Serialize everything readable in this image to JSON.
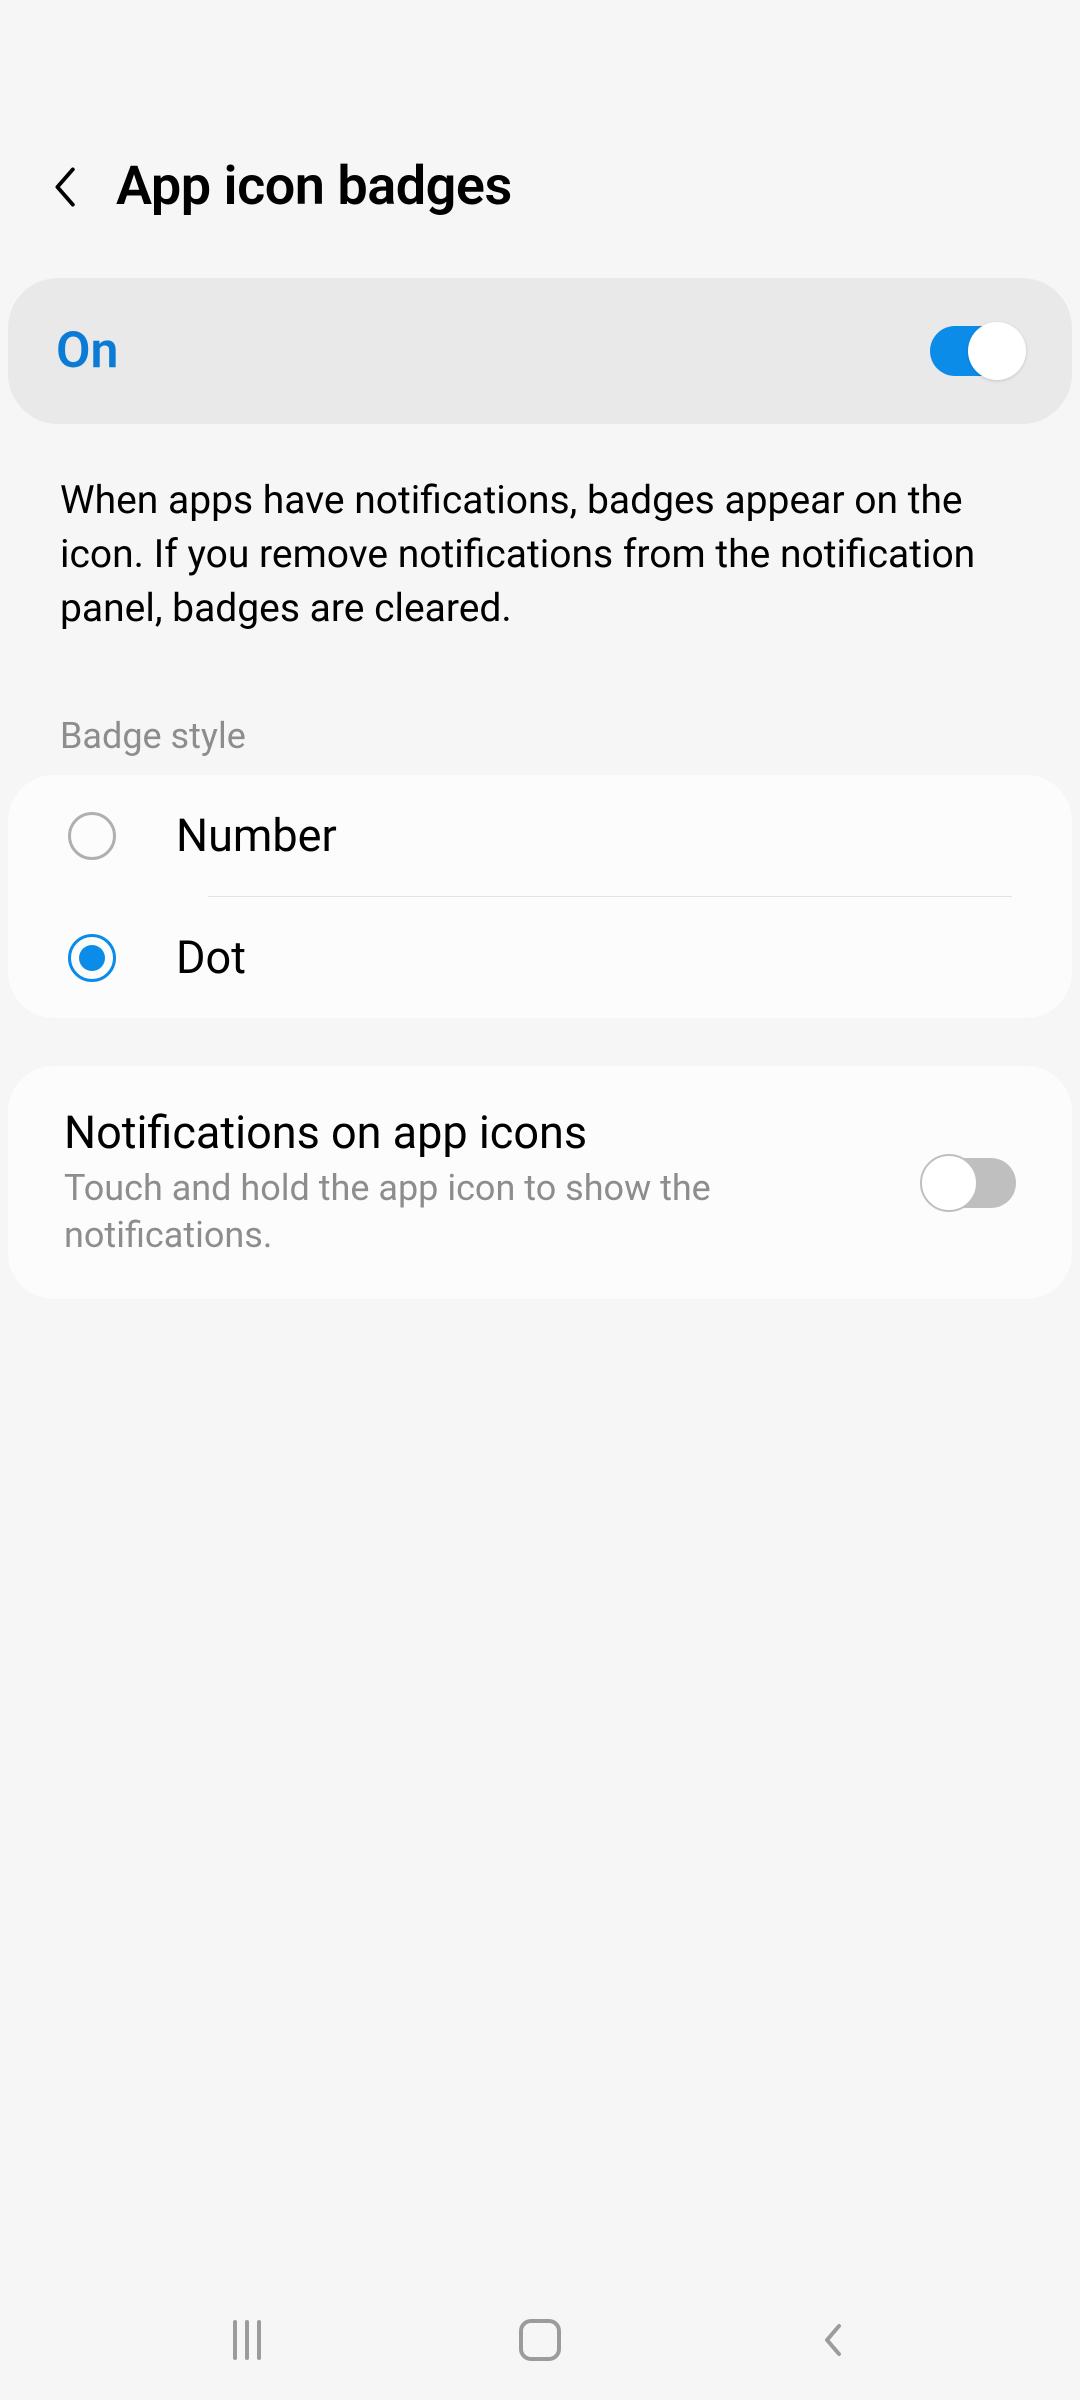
{
  "header": {
    "title": "App icon badges"
  },
  "master": {
    "label": "On",
    "enabled": true
  },
  "description": "When apps have notifications, badges appear on the icon. If you remove notifications from the notification panel, badges are cleared.",
  "badge_style": {
    "section_label": "Badge style",
    "options": [
      {
        "label": "Number",
        "selected": false
      },
      {
        "label": "Dot",
        "selected": true
      }
    ]
  },
  "notifications_on_icons": {
    "title": "Notifications on app icons",
    "subtitle": "Touch and hold the app icon to show the notifications.",
    "enabled": false
  },
  "colors": {
    "accent": "#0c8ce9",
    "background": "#f6f6f6"
  }
}
